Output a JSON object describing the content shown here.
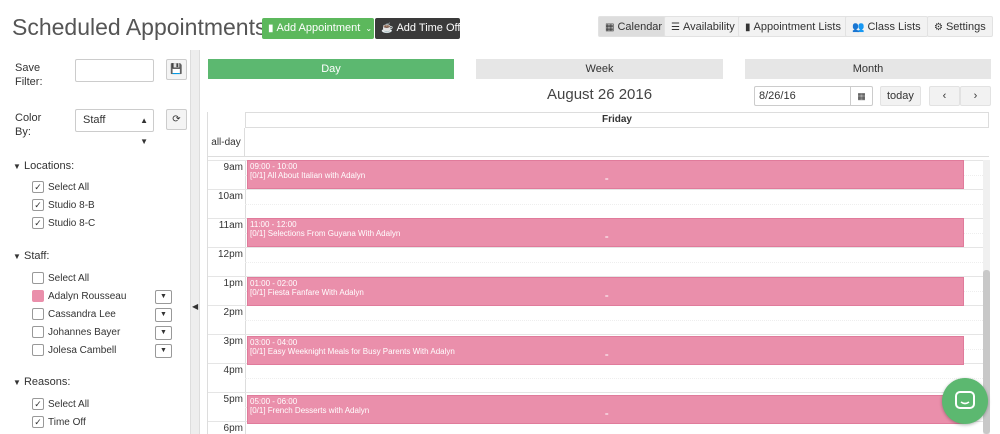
{
  "header": {
    "title": "Scheduled Appointments",
    "add_appointment": "Add Appointment",
    "add_time_off": "Add Time Off",
    "nav": {
      "calendar": "Calendar",
      "availability": "Availability",
      "appointment_lists": "Appointment Lists",
      "class_lists": "Class Lists",
      "settings": "Settings"
    }
  },
  "sidebar": {
    "save_filter_label": "Save Filter:",
    "color_by_label": "Color By:",
    "color_by_value": "Staff",
    "locations": {
      "title": "Locations:",
      "items": [
        {
          "label": "Select All",
          "checked": "✓"
        },
        {
          "label": "Studio 8-B",
          "checked": "✓"
        },
        {
          "label": "Studio 8-C",
          "checked": "✓"
        }
      ]
    },
    "staff": {
      "title": "Staff:",
      "items": [
        {
          "label": "Select All"
        },
        {
          "label": "Adalyn Rousseau",
          "color": "#ea8fab"
        },
        {
          "label": "Cassandra Lee"
        },
        {
          "label": "Johannes Bayer"
        },
        {
          "label": "Jolesa Cambell"
        }
      ]
    },
    "reasons": {
      "title": "Reasons:",
      "items": [
        {
          "label": "Select All",
          "checked": "✓"
        },
        {
          "label": "Time Off",
          "checked": "✓"
        }
      ]
    }
  },
  "calendar": {
    "views": {
      "day": "Day",
      "week": "Week",
      "month": "Month"
    },
    "date_title": "August 26 2016",
    "date_input": "8/26/16",
    "today": "today",
    "day_header": "Friday",
    "allday_label": "all-day",
    "hours": [
      "9am",
      "10am",
      "11am",
      "12pm",
      "1pm",
      "2pm",
      "3pm",
      "4pm",
      "5pm",
      "6pm"
    ],
    "events": [
      {
        "time": "09:00 - 10:00",
        "title": "[0/1] All About Italian with Adalyn"
      },
      {
        "time": "11:00 - 12:00",
        "title": "[0/1] Selections From Guyana With Adalyn"
      },
      {
        "time": "01:00 - 02:00",
        "title": "[0/1] Fiesta Fanfare With Adalyn"
      },
      {
        "time": "03:00 - 04:00",
        "title": "[0/1] Easy Weeknight Meals for Busy Parents With Adalyn"
      },
      {
        "time": "05:00 - 06:00",
        "title": "[0/1] French Desserts with Adalyn"
      }
    ],
    "event_color": "#ea8fab"
  },
  "colors": {
    "green": "#5cb85c",
    "dark": "#3a3a3a",
    "pink": "#ea8fab"
  }
}
